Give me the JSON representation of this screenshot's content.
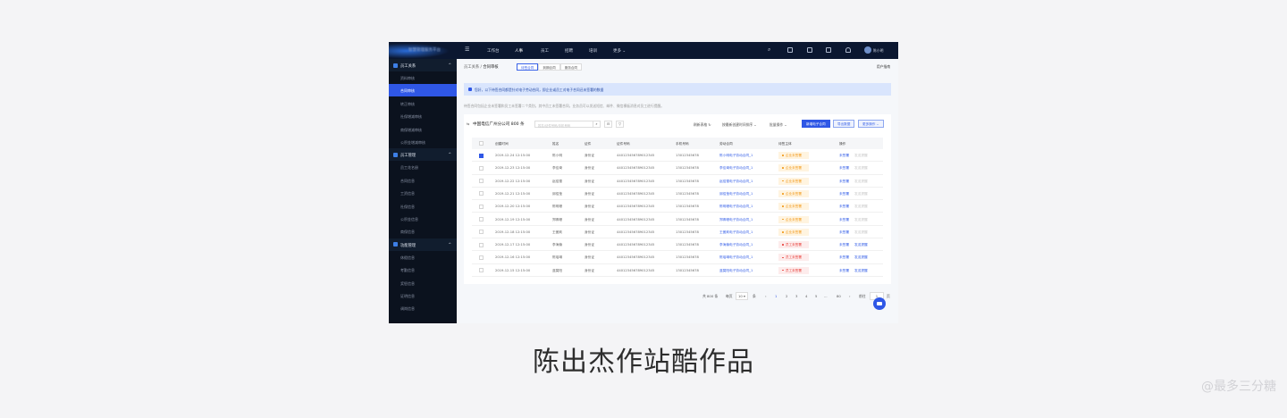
{
  "topbar": {
    "brand": "智慧管理服务平台",
    "nav": [
      "工作台",
      "人事",
      "员工",
      "招聘",
      "培训",
      "更多"
    ],
    "active_nav": "人事",
    "user": "陈小明"
  },
  "sidebar": {
    "groups": [
      {
        "label": "员工关系",
        "items": [
          "资料审核",
          "合同审核",
          "转正审核",
          "社保增减审核",
          "商保增减审核",
          "公积金增减审核"
        ]
      },
      {
        "label": "员工管理",
        "items": [
          "员工花名册",
          "合同信息",
          "工资信息",
          "社保信息",
          "公积金信息",
          "商保信息"
        ]
      },
      {
        "label": "功能管理",
        "items": [
          "休假信息",
          "考勤信息",
          "奖惩信息",
          "证明信息",
          "调岗信息"
        ]
      }
    ],
    "active_item": "合同审核"
  },
  "breadcrumb": {
    "parent": "员工关系",
    "current": "合同审核"
  },
  "tabs": [
    "待签合同",
    "到期合同",
    "服务合同"
  ],
  "user_guide": "用户指南",
  "notice": "您好，以下待签合同都是针对电子劳动合同，即企业或员工对电子合同还未签署的数据",
  "description": "待签合同包括企业未签署和员工未签署二个类别，其中员工未签署合同，业务员可以发送短信、邮件、微信模板消息对员工进行提醒。",
  "card": {
    "title": "中国电信广州分公司 800 条",
    "search_placeholder": "姓名/证件号码/手机号码",
    "refresh": "刷新表格",
    "sort": "按最新创建时间排序",
    "batch": "批量操作",
    "new_btn": "新增电子合同",
    "export_btn": "导出数据",
    "more_btn": "更多操作"
  },
  "columns": [
    "创建时间",
    "姓名",
    "证件",
    "证件号码",
    "手机号码",
    "劳动合同",
    "待签主体",
    "操作"
  ],
  "rows": [
    {
      "time": "2019-12-24  12:15:00",
      "name": "陈小明",
      "idtype": "身份证",
      "idno": "440123456789012345",
      "phone": "13012345678",
      "contract": "陈小明电子劳动合同_1",
      "status": "企业未签署",
      "st": "o",
      "checked": true,
      "remind_enabled": false
    },
    {
      "time": "2019-12-23  12:15:00",
      "name": "李佳琦",
      "idtype": "身份证",
      "idno": "440123456789012345",
      "phone": "13012345678",
      "contract": "李佳琦电子劳动合同_1",
      "status": "企业未签署",
      "st": "o",
      "checked": false,
      "remind_enabled": false
    },
    {
      "time": "2019-12-22  12:15:00",
      "name": "赵绍雪",
      "idtype": "身份证",
      "idno": "440123456789012345",
      "phone": "13012345678",
      "contract": "赵绍雪电子劳动合同_1",
      "status": "企业未签署",
      "st": "o",
      "checked": false,
      "remind_enabled": false
    },
    {
      "time": "2019-12-21  12:15:00",
      "name": "邱绍莹",
      "idtype": "身份证",
      "idno": "440123456789012345",
      "phone": "13012345678",
      "contract": "邱绍莹电子劳动合同_1",
      "status": "企业未签署",
      "st": "o",
      "checked": false,
      "remind_enabled": false
    },
    {
      "time": "2019-12-20  12:15:00",
      "name": "陈明珊",
      "idtype": "身份证",
      "idno": "440123456789012345",
      "phone": "13012345678",
      "contract": "陈明珊电子劳动合同_1",
      "status": "企业未签署",
      "st": "o",
      "checked": false,
      "remind_enabled": false
    },
    {
      "time": "2019-12-19  12:15:00",
      "name": "郑卿珊",
      "idtype": "身份证",
      "idno": "440123456789012345",
      "phone": "13012345678",
      "contract": "郑卿珊电子劳动合同_1",
      "status": "企业未签署",
      "st": "o",
      "checked": false,
      "remind_enabled": false
    },
    {
      "time": "2019-12-18  12:15:00",
      "name": "王傲莉",
      "idtype": "身份证",
      "idno": "440123456789012345",
      "phone": "13012345678",
      "contract": "王傲莉电子劳动合同_1",
      "status": "企业未签署",
      "st": "o",
      "checked": false,
      "remind_enabled": false
    },
    {
      "time": "2019-12-17  12:15:00",
      "name": "李海楠",
      "idtype": "身份证",
      "idno": "440123456789012345",
      "phone": "13012345678",
      "contract": "李海楠电子劳动合同_1",
      "status": "员工未签署",
      "st": "r",
      "checked": false,
      "remind_enabled": true
    },
    {
      "time": "2019-12-16  12:15:00",
      "name": "陈瑶琳",
      "idtype": "身份证",
      "idno": "440123456789012345",
      "phone": "13012345678",
      "contract": "陈瑶琳电子劳动合同_1",
      "status": "员工未签署",
      "st": "r",
      "checked": false,
      "remind_enabled": true
    },
    {
      "time": "2019-12-15  12:15:00",
      "name": "蓝莫阳",
      "idtype": "身份证",
      "idno": "440123456789012345",
      "phone": "13012345678",
      "contract": "蓝莫阳电子劳动合同_1",
      "status": "员工未签署",
      "st": "r",
      "checked": false,
      "remind_enabled": true
    }
  ],
  "actions": {
    "view": "未签署",
    "remind": "发送提醒"
  },
  "pagination": {
    "total": "共 800 条",
    "per_page_label": "每页",
    "per_page": "10",
    "unit": "条",
    "pages": [
      "1",
      "2",
      "3",
      "4",
      "5",
      "...",
      "80"
    ],
    "current": "1",
    "goto": "前往",
    "goto_value": "1",
    "page_unit": "页"
  },
  "caption": "陈出杰作站酷作品",
  "watermark": "@最多三分糖",
  "colors": {
    "primary": "#2f57e6",
    "sidebar": "#0b121e",
    "topbar": "#0b1730",
    "warning": "#f29a1b",
    "danger": "#e8413c"
  }
}
